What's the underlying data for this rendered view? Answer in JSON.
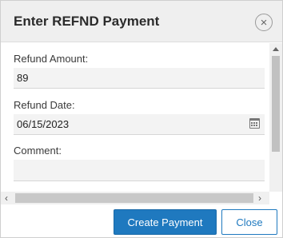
{
  "dialog": {
    "title": "Enter REFND Payment",
    "close_icon": "close-circle-icon"
  },
  "form": {
    "refund_amount_label": "Refund Amount:",
    "refund_amount_value": "89",
    "refund_date_label": "Refund Date:",
    "refund_date_value": "06/15/2023",
    "calendar_icon": "calendar-icon",
    "comment_label": "Comment:",
    "comment_value": ""
  },
  "scrollbars": {
    "h_left_arrow": "‹",
    "h_right_arrow": "›"
  },
  "footer": {
    "create_label": "Create Payment",
    "close_label": "Close"
  },
  "colors": {
    "primary": "#1f79bf",
    "header_bg": "#efefef",
    "field_bg": "#f3f3f3"
  }
}
